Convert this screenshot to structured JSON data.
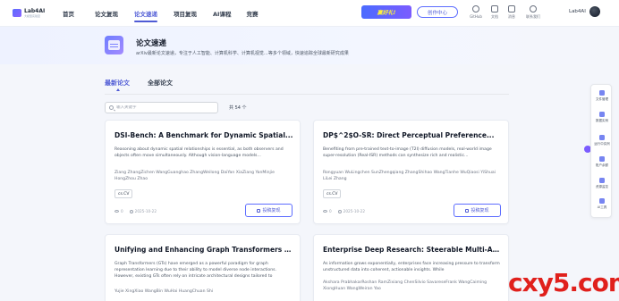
{
  "app": {
    "logo_name": "Lab4AI",
    "logo_sub": "大模型实验室"
  },
  "nav": {
    "items": [
      {
        "label": "首页"
      },
      {
        "label": "论文复现"
      },
      {
        "label": "论文速递"
      },
      {
        "label": "项目复现"
      },
      {
        "label": "AI课程"
      },
      {
        "label": "竞赛"
      }
    ],
    "active_index": 2
  },
  "header_actions": {
    "promo_label": "赢好礼!",
    "creator_label": "创作中心",
    "icons": [
      {
        "name": "github-icon",
        "label": "GitHub"
      },
      {
        "name": "docs-icon",
        "label": "文档"
      },
      {
        "name": "message-icon",
        "label": "消息"
      },
      {
        "name": "contact-icon",
        "label": "联系我们"
      }
    ],
    "user_name": "Lab4AI"
  },
  "page": {
    "title": "论文速递",
    "description": "arXiv最新论文速递，专注于人工智能、计算机科学、计算机视觉…等多个领域，快速追踪全球最新研究成果"
  },
  "tabs": [
    {
      "label": "最新论文"
    },
    {
      "label": "全部论文"
    }
  ],
  "search": {
    "placeholder": "输入关键字",
    "count_label": "共 54 个"
  },
  "cards": [
    {
      "title": "DSI-Bench: A Benchmark for Dynamic Spatial...",
      "abstract": "Reasoning about dynamic spatial relationships is essential, as both observers and objects often move simultaneously. Although vision-language models...",
      "authors": "Ziang ZhangZichen WangGuanghao ZhangWeilong DaiYan XiaZiang YanMinjie HongZhou Zhao",
      "tag": "cs.CV",
      "views": "0",
      "date": "2025-10-22",
      "button_label": "投稿复现"
    },
    {
      "title": "DP$^2$O-SR: Direct Perceptual Preference...",
      "abstract": "Benefiting from pre-trained text-to-image (T2I) diffusion models, real-world image super-resolution (Real-ISR) methods can synthesize rich and realistic...",
      "authors": "Rongyuan WuLingchen SunZhengqiang ZhangShihao WangTianhe WuQiaosi YiShuai LiLei Zhang",
      "tag": "cs.CV",
      "views": "0",
      "date": "2025-10-22",
      "button_label": "投稿复现"
    },
    {
      "title": "Unifying and Enhancing Graph Transformers via a...",
      "abstract": "Graph Transformers (GTs) have emerged as a powerful paradigm for graph representation learning due to their ability to model diverse node interactions. However, existing GTs often rely on intricate architectural designs tailored to",
      "authors": "Yujie XingXiao WangBin WuHai HuangChuan Shi",
      "tag": "",
      "views": "",
      "date": "",
      "button_label": ""
    },
    {
      "title": "Enterprise Deep Research: Steerable Multi-Agent...",
      "abstract": "As information grows exponentially, enterprises face increasing pressure to transform unstructured data into coherent, actionable insights. While",
      "authors": "Akshara PrabhakarRoshan RamZixiang ChenSilvio SavareseFrank WangCaiming XiongHuan WangWeiran Yao",
      "tag": "",
      "views": "",
      "date": "",
      "button_label": ""
    }
  ],
  "side_toolbar": [
    {
      "label": "文件管理"
    },
    {
      "label": "数据实例"
    },
    {
      "label": "运行中实例"
    },
    {
      "label": "账户余额"
    },
    {
      "label": "资源监控"
    },
    {
      "label": "AI工具"
    }
  ],
  "watermark": "cxy5.com",
  "colors": {
    "accent": "#4f5bd5",
    "background": "#f4f6fb",
    "watermark": "#e0201c"
  }
}
